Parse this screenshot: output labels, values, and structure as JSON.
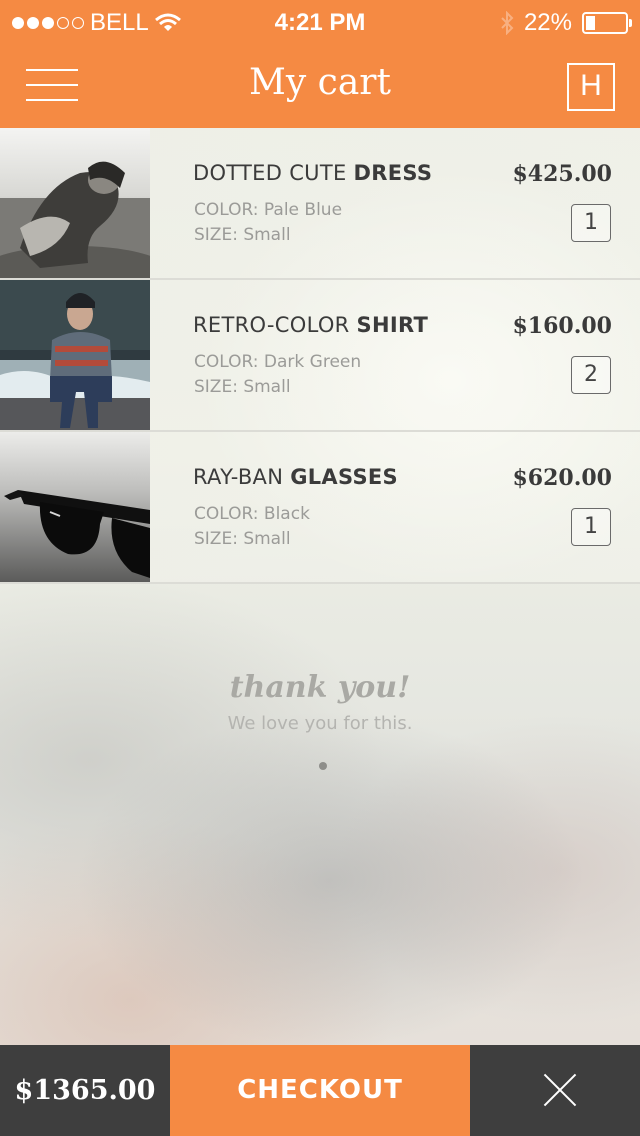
{
  "status_bar": {
    "carrier": "BELL",
    "time": "4:21 PM",
    "battery": "22%",
    "signal_icon": "signal-dots-icon",
    "wifi_icon": "wifi-icon",
    "bluetooth_icon": "bluetooth-icon"
  },
  "header": {
    "title": "My cart",
    "menu_icon": "hamburger-menu-icon",
    "right_button_label": "H"
  },
  "colors": {
    "accent": "#f58a43",
    "dark": "#3e3e3e"
  },
  "cart": {
    "items": [
      {
        "name_light": "DOTTED CUTE",
        "name_bold": "DRESS",
        "color": "COLOR: Pale Blue",
        "size": "SIZE: Small",
        "price": "$425.00",
        "quantity": "1"
      },
      {
        "name_light": "RETRO-COLOR",
        "name_bold": "SHIRT",
        "color": "COLOR: Dark Green",
        "size": "SIZE: Small",
        "price": "$160.00",
        "quantity": "2"
      },
      {
        "name_light": "RAY-BAN",
        "name_bold": "GLASSES",
        "color": "COLOR: Black",
        "size": "SIZE: Small",
        "price": "$620.00",
        "quantity": "1"
      }
    ]
  },
  "message": {
    "thanks": "thank you!",
    "love": "We love you for this."
  },
  "footer": {
    "total": "$1365.00",
    "checkout_label": "CHECKOUT",
    "close_icon": "close-icon"
  }
}
